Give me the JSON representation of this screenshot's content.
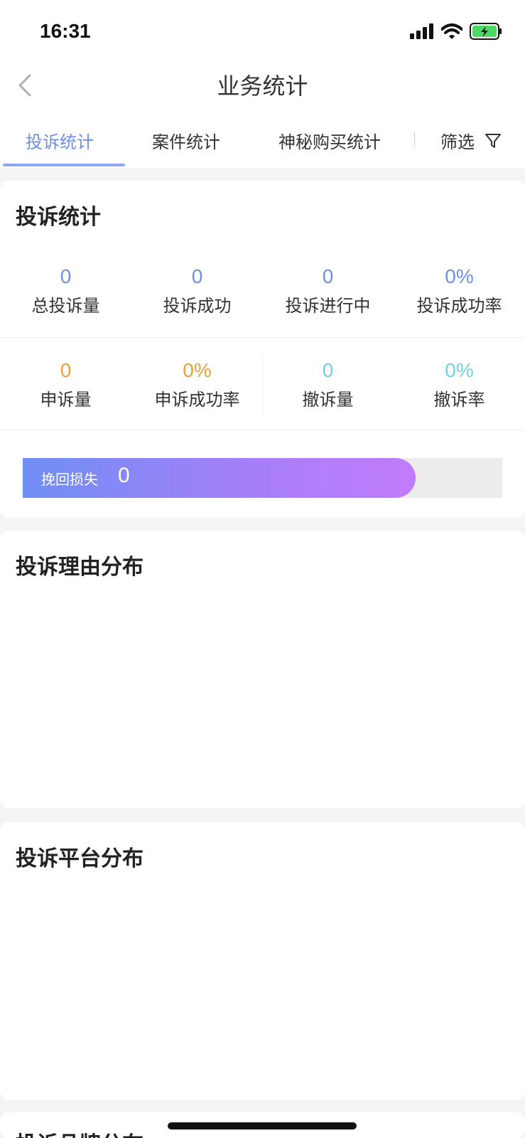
{
  "status_bar": {
    "time": "16:31",
    "icons": [
      "signal-icon",
      "wifi-icon",
      "battery-charging-icon"
    ]
  },
  "nav": {
    "title": "业务统计",
    "back_icon": "chevron-left-icon"
  },
  "tabs": {
    "items": [
      {
        "label": "投诉统计",
        "active": true
      },
      {
        "label": "案件统计",
        "active": false
      },
      {
        "label": "神秘购买统计",
        "active": false
      }
    ],
    "filter_label": "筛选",
    "filter_icon": "filter-icon"
  },
  "complaint_card": {
    "title": "投诉统计",
    "row1": [
      {
        "value": "0",
        "label": "总投诉量"
      },
      {
        "value": "0",
        "label": "投诉成功"
      },
      {
        "value": "0",
        "label": "投诉进行中"
      },
      {
        "value": "0%",
        "label": "投诉成功率"
      }
    ],
    "row2": [
      {
        "value": "0",
        "label": "申诉量"
      },
      {
        "value": "0%",
        "label": "申诉成功率"
      },
      {
        "value": "0",
        "label": "撤诉量"
      },
      {
        "value": "0%",
        "label": "撤诉率"
      }
    ],
    "loss": {
      "label": "挽回损失",
      "value": "0"
    }
  },
  "reason_card": {
    "title": "投诉理由分布"
  },
  "platform_card": {
    "title": "投诉平台分布"
  },
  "brand_card": {
    "title": "投诉品牌分布"
  },
  "colors": {
    "accent_blue": "#6f8fe7",
    "orange": "#e9a13b",
    "cyan": "#6fd3e0",
    "gradient_start": "#6f8ff5",
    "gradient_end": "#c27cfb"
  }
}
